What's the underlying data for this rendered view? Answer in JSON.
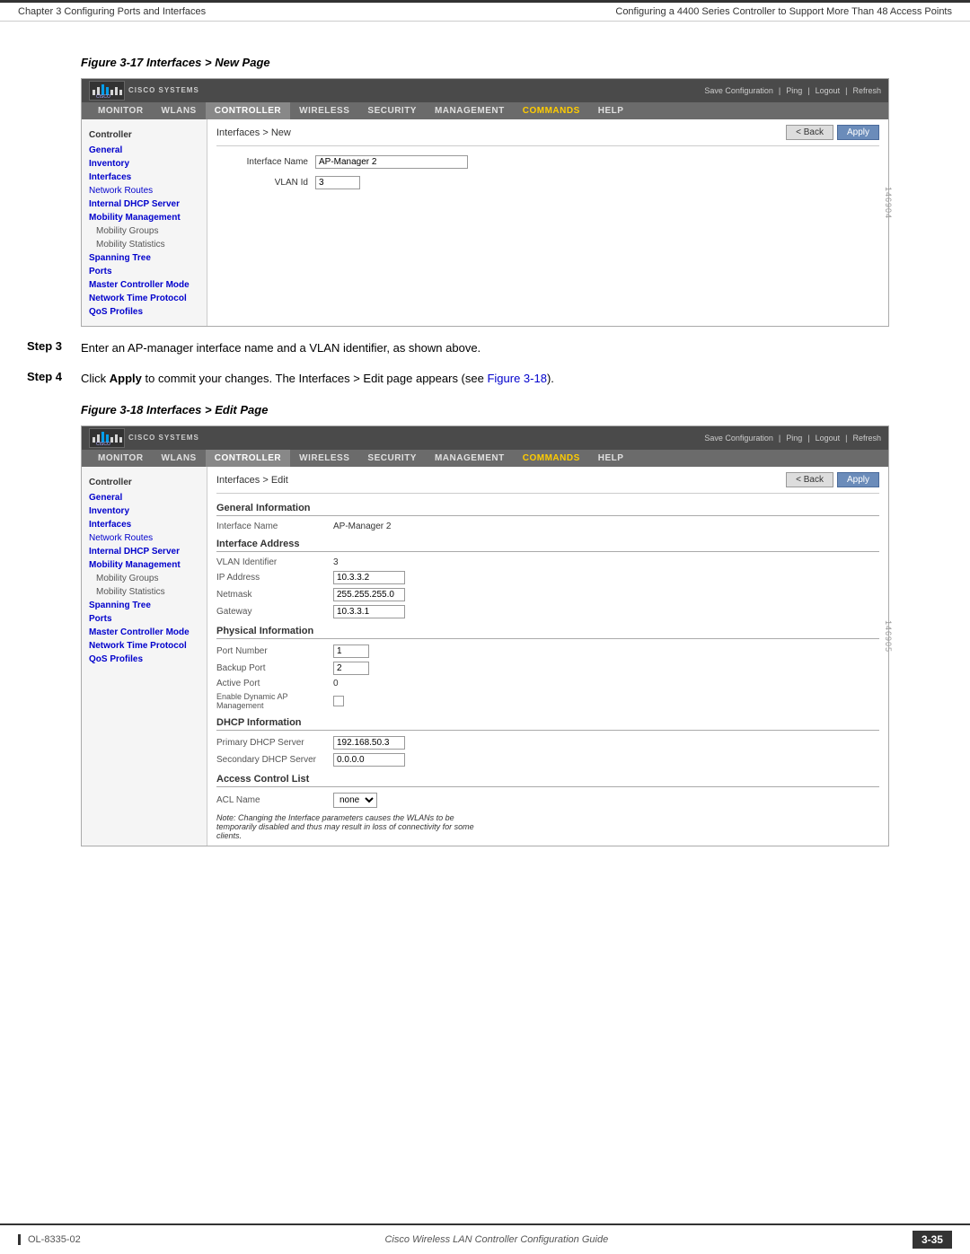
{
  "page": {
    "chapter_left": "Chapter 3    Configuring Ports and Interfaces",
    "chapter_right": "Configuring a 4400 Series Controller to Support More Than 48 Access Points",
    "footer_left": "OL-8335-02",
    "footer_right": "3-35",
    "footer_center": "Cisco Wireless LAN Controller Configuration Guide"
  },
  "figure17": {
    "title": "Figure 3-17   Interfaces > New Page",
    "id": "146904"
  },
  "figure18": {
    "title": "Figure 3-18   Interfaces > Edit Page",
    "id": "146905"
  },
  "steps": {
    "step3_label": "Step 3",
    "step3_text": "Enter an AP-manager interface name and a VLAN identifier, as shown above.",
    "step4_label": "Step 4",
    "step4_text_pre": "Click ",
    "step4_bold": "Apply",
    "step4_text_post": " to commit your changes. The Interfaces > Edit page appears (see ",
    "step4_link": "Figure 3-18",
    "step4_text_end": ")."
  },
  "cisco_ui": {
    "logo_text_line1": "Cisco Systems",
    "topbar_right": [
      "Save Configuration",
      "Ping",
      "Logout",
      "Refresh"
    ],
    "nav_items": [
      "MONITOR",
      "WLANs",
      "CONTROLLER",
      "WIRELESS",
      "SECURITY",
      "MANAGEMENT",
      "COMMANDS",
      "HELP"
    ],
    "active_nav": "CONTROLLER"
  },
  "panel_new": {
    "breadcrumb": "Interfaces > New",
    "back_btn": "< Back",
    "apply_btn": "Apply",
    "fields": [
      {
        "label": "Interface Name",
        "value": "AP-Manager 2",
        "type": "text"
      },
      {
        "label": "VLAN Id",
        "value": "3",
        "type": "text"
      }
    ],
    "sidebar_title": "Controller",
    "sidebar_items": [
      {
        "text": "General",
        "bold": true,
        "indent": false
      },
      {
        "text": "Inventory",
        "bold": true,
        "indent": false
      },
      {
        "text": "Interfaces",
        "bold": true,
        "indent": false
      },
      {
        "text": "Network Routes",
        "bold": false,
        "indent": false
      },
      {
        "text": "Internal DHCP Server",
        "bold": true,
        "indent": false
      },
      {
        "text": "Mobility Management",
        "bold": true,
        "indent": false
      },
      {
        "text": "Mobility Groups",
        "bold": false,
        "indent": true
      },
      {
        "text": "Mobility Statistics",
        "bold": false,
        "indent": true
      },
      {
        "text": "Spanning Tree",
        "bold": true,
        "indent": false
      },
      {
        "text": "Ports",
        "bold": true,
        "indent": false
      },
      {
        "text": "Master Controller Mode",
        "bold": true,
        "indent": false
      },
      {
        "text": "Network Time Protocol",
        "bold": true,
        "indent": false
      },
      {
        "text": "QoS Profiles",
        "bold": true,
        "indent": false
      }
    ]
  },
  "panel_edit": {
    "breadcrumb": "Interfaces > Edit",
    "back_btn": "< Back",
    "apply_btn": "Apply",
    "sidebar_title": "Controller",
    "sidebar_items": [
      {
        "text": "General",
        "bold": true,
        "indent": false
      },
      {
        "text": "Inventory",
        "bold": true,
        "indent": false
      },
      {
        "text": "Interfaces",
        "bold": true,
        "indent": false
      },
      {
        "text": "Network Routes",
        "bold": false,
        "indent": false
      },
      {
        "text": "Internal DHCP Server",
        "bold": true,
        "indent": false
      },
      {
        "text": "Mobility Management",
        "bold": true,
        "indent": false
      },
      {
        "text": "Mobility Groups",
        "bold": false,
        "indent": true
      },
      {
        "text": "Mobility Statistics",
        "bold": false,
        "indent": true
      },
      {
        "text": "Spanning Tree",
        "bold": true,
        "indent": false
      },
      {
        "text": "Ports",
        "bold": true,
        "indent": false
      },
      {
        "text": "Master Controller Mode",
        "bold": true,
        "indent": false
      },
      {
        "text": "Network Time Protocol",
        "bold": true,
        "indent": false
      },
      {
        "text": "QoS Profiles",
        "bold": true,
        "indent": false
      }
    ],
    "sections": {
      "general_info": {
        "title": "General Information",
        "interface_name_label": "Interface Name",
        "interface_name_value": "AP-Manager 2"
      },
      "interface_address": {
        "title": "Interface Address",
        "fields": [
          {
            "label": "VLAN Identifier",
            "value": "3"
          },
          {
            "label": "IP Address",
            "value": "10.3.3.2"
          },
          {
            "label": "Netmask",
            "value": "255.255.255.0"
          },
          {
            "label": "Gateway",
            "value": "10.3.3.1"
          }
        ]
      },
      "physical_info": {
        "title": "Physical Information",
        "fields": [
          {
            "label": "Port Number",
            "value": "1",
            "input": true
          },
          {
            "label": "Backup Port",
            "value": "2",
            "input": true
          },
          {
            "label": "Active Port",
            "value": "0",
            "input": false
          },
          {
            "label": "Enable Dynamic AP Management",
            "value": "",
            "checkbox": true
          }
        ]
      },
      "dhcp_info": {
        "title": "DHCP Information",
        "fields": [
          {
            "label": "Primary DHCP Server",
            "value": "192.168.50.3"
          },
          {
            "label": "Secondary DHCP Server",
            "value": "0.0.0.0"
          }
        ]
      },
      "acl": {
        "title": "Access Control List",
        "acl_label": "ACL Name",
        "acl_value": "none"
      },
      "note": "Note: Changing the Interface parameters causes the WLANs to be temporarily disabled and thus may result in loss of connectivity for some clients."
    }
  }
}
